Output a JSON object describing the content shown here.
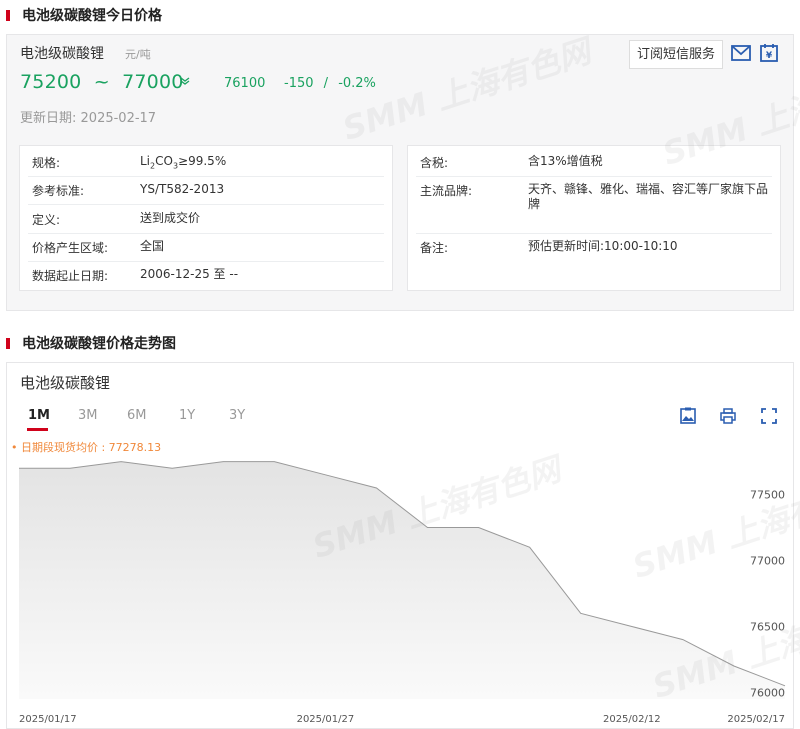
{
  "section1": {
    "title": "电池级碳酸锂今日价格"
  },
  "price_card": {
    "name": "电池级碳酸锂",
    "unit": "元/吨",
    "low": "75200",
    "tilde": "~",
    "high": "77000",
    "trend_icon": "down-chevron-icon",
    "average": "76100",
    "change": "-150",
    "separator": "/",
    "change_pct": "-0.2%",
    "update_label": "更新日期:",
    "update_date": "2025-02-17",
    "subscribe_label": "订阅短信服务",
    "left_info": [
      {
        "label": "规格:",
        "value_prefix": "Li",
        "sub1": "2",
        "mid": "CO",
        "sub2": "3",
        "value_suffix": "≥99.5%"
      },
      {
        "label": "参考标准:",
        "value": "YS/T582-2013"
      },
      {
        "label": "定义:",
        "value": "送到成交价"
      },
      {
        "label": "价格产生区域:",
        "value": "全国"
      },
      {
        "label": "数据起止日期:",
        "value": "2006-12-25 至 --"
      }
    ],
    "right_info": [
      {
        "label": "含税:",
        "value": "含13%增值税"
      },
      {
        "label": "主流品牌:",
        "value": "天齐、赣锋、雅化、瑞福、容汇等厂家旗下品牌"
      },
      {
        "label": "备注:",
        "value": "预估更新时间:10:00-10:10"
      }
    ]
  },
  "section2": {
    "title": "电池级碳酸锂价格走势图"
  },
  "chart_card": {
    "name": "电池级碳酸锂",
    "tabs": [
      "1M",
      "3M",
      "6M",
      "1Y",
      "3Y"
    ],
    "active_tab": "1M",
    "avg_label": "日期段现货均价 : 77278.13",
    "watermark": "SMM 上海有色网"
  },
  "chart_data": {
    "type": "area",
    "x": [
      "2025/01/17",
      "2025/01/20",
      "2025/01/21",
      "2025/01/22",
      "2025/01/23",
      "2025/01/24",
      "2025/01/27",
      "2025/02/05",
      "2025/02/06",
      "2025/02/07",
      "2025/02/10",
      "2025/02/11",
      "2025/02/12",
      "2025/02/13",
      "2025/02/14",
      "2025/02/17"
    ],
    "y": [
      77700,
      77700,
      77750,
      77700,
      77750,
      77750,
      77650,
      77550,
      77250,
      77250,
      77100,
      76600,
      76500,
      76400,
      76200,
      76050
    ],
    "x_tick_labels": [
      "2025/01/17",
      "2025/01/27",
      "2025/02/12",
      "2025/02/17"
    ],
    "y_ticks": [
      76000,
      76500,
      77000,
      77500
    ],
    "ylim": [
      75950,
      77800
    ],
    "average": 77278.13,
    "series_color": "#999999",
    "fill_color": "#e6e6e6",
    "grid": false
  }
}
